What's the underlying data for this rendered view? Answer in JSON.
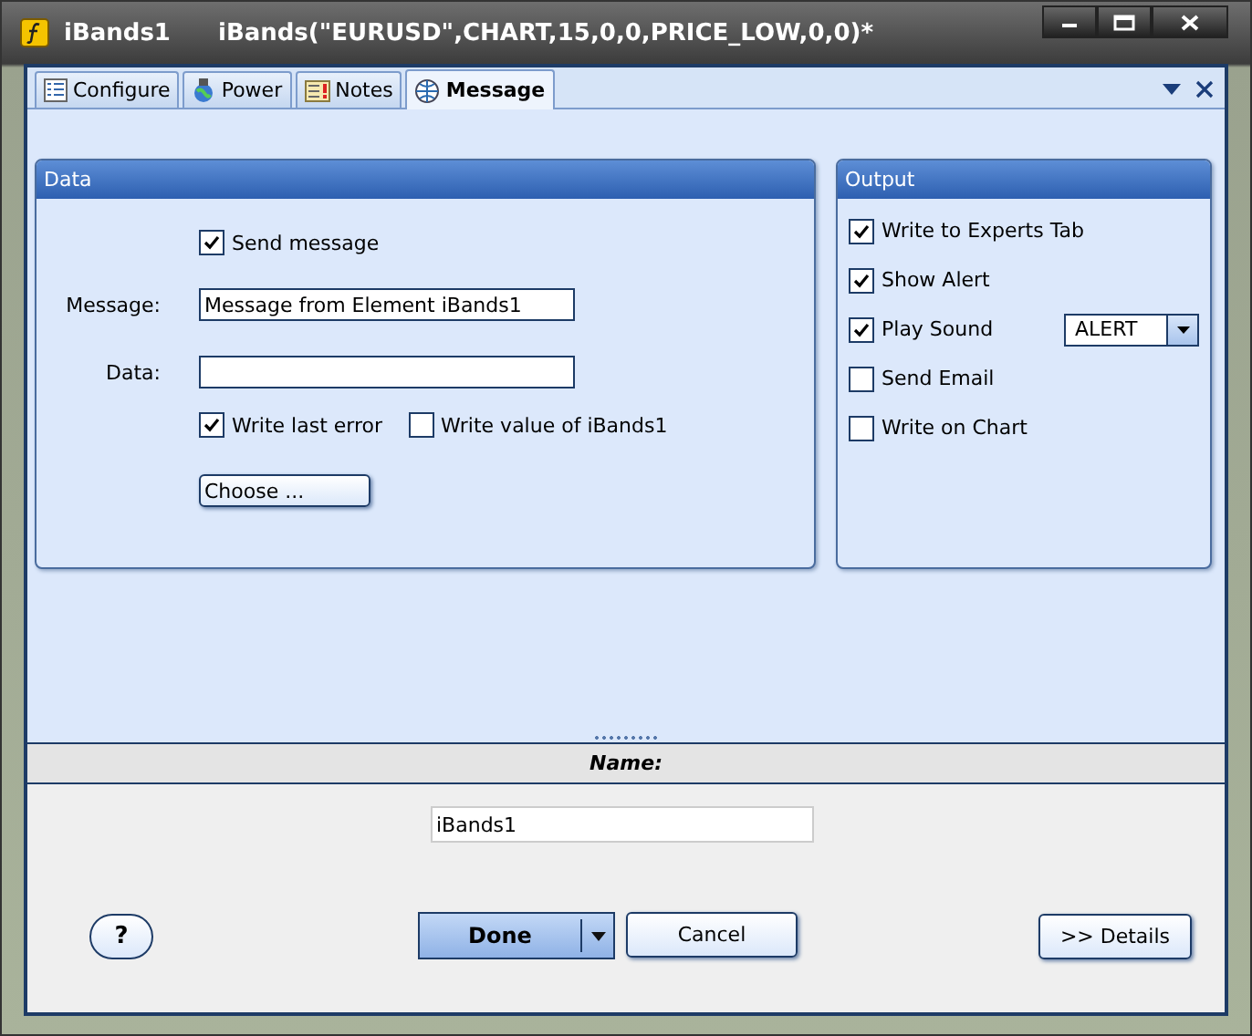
{
  "window": {
    "title": "iBands1",
    "subtitle": "iBands(\"EURUSD\",CHART,15,0,0,PRICE_LOW,0,0)*"
  },
  "tabs": [
    {
      "label": "Configure",
      "selected": false
    },
    {
      "label": "Power",
      "selected": false
    },
    {
      "label": "Notes",
      "selected": false
    },
    {
      "label": "Message",
      "selected": true
    }
  ],
  "data_panel": {
    "title": "Data",
    "send_message": {
      "label": "Send message",
      "checked": true
    },
    "fields": [
      {
        "label": "Message:",
        "value": "Message from Element iBands1"
      },
      {
        "label": "Data:"
      }
    ],
    "options": [
      {
        "label": "Write last error",
        "checked": true
      },
      {
        "label": "Write value of iBands1",
        "checked": false
      }
    ],
    "choose_button": "Choose ..."
  },
  "output_panel": {
    "title": "Output",
    "items": [
      {
        "kind": "checkbox",
        "label": "Write to Experts Tab",
        "checked": true
      },
      {
        "kind": "checkbox",
        "label": "Show Alert",
        "checked": true
      },
      {
        "kind": "checkbox_dropdown",
        "label": "Play Sound",
        "checked": true,
        "dropdown": "ALERT"
      },
      {
        "kind": "checkbox",
        "label": "Send Email",
        "checked": false
      },
      {
        "kind": "checkbox",
        "label": "Write on Chart",
        "checked": false
      }
    ]
  },
  "name_section": {
    "header": "Name:",
    "value": "iBands1"
  },
  "buttons": {
    "help": "?",
    "done": "Done",
    "cancel": "Cancel",
    "details": ">> Details"
  }
}
